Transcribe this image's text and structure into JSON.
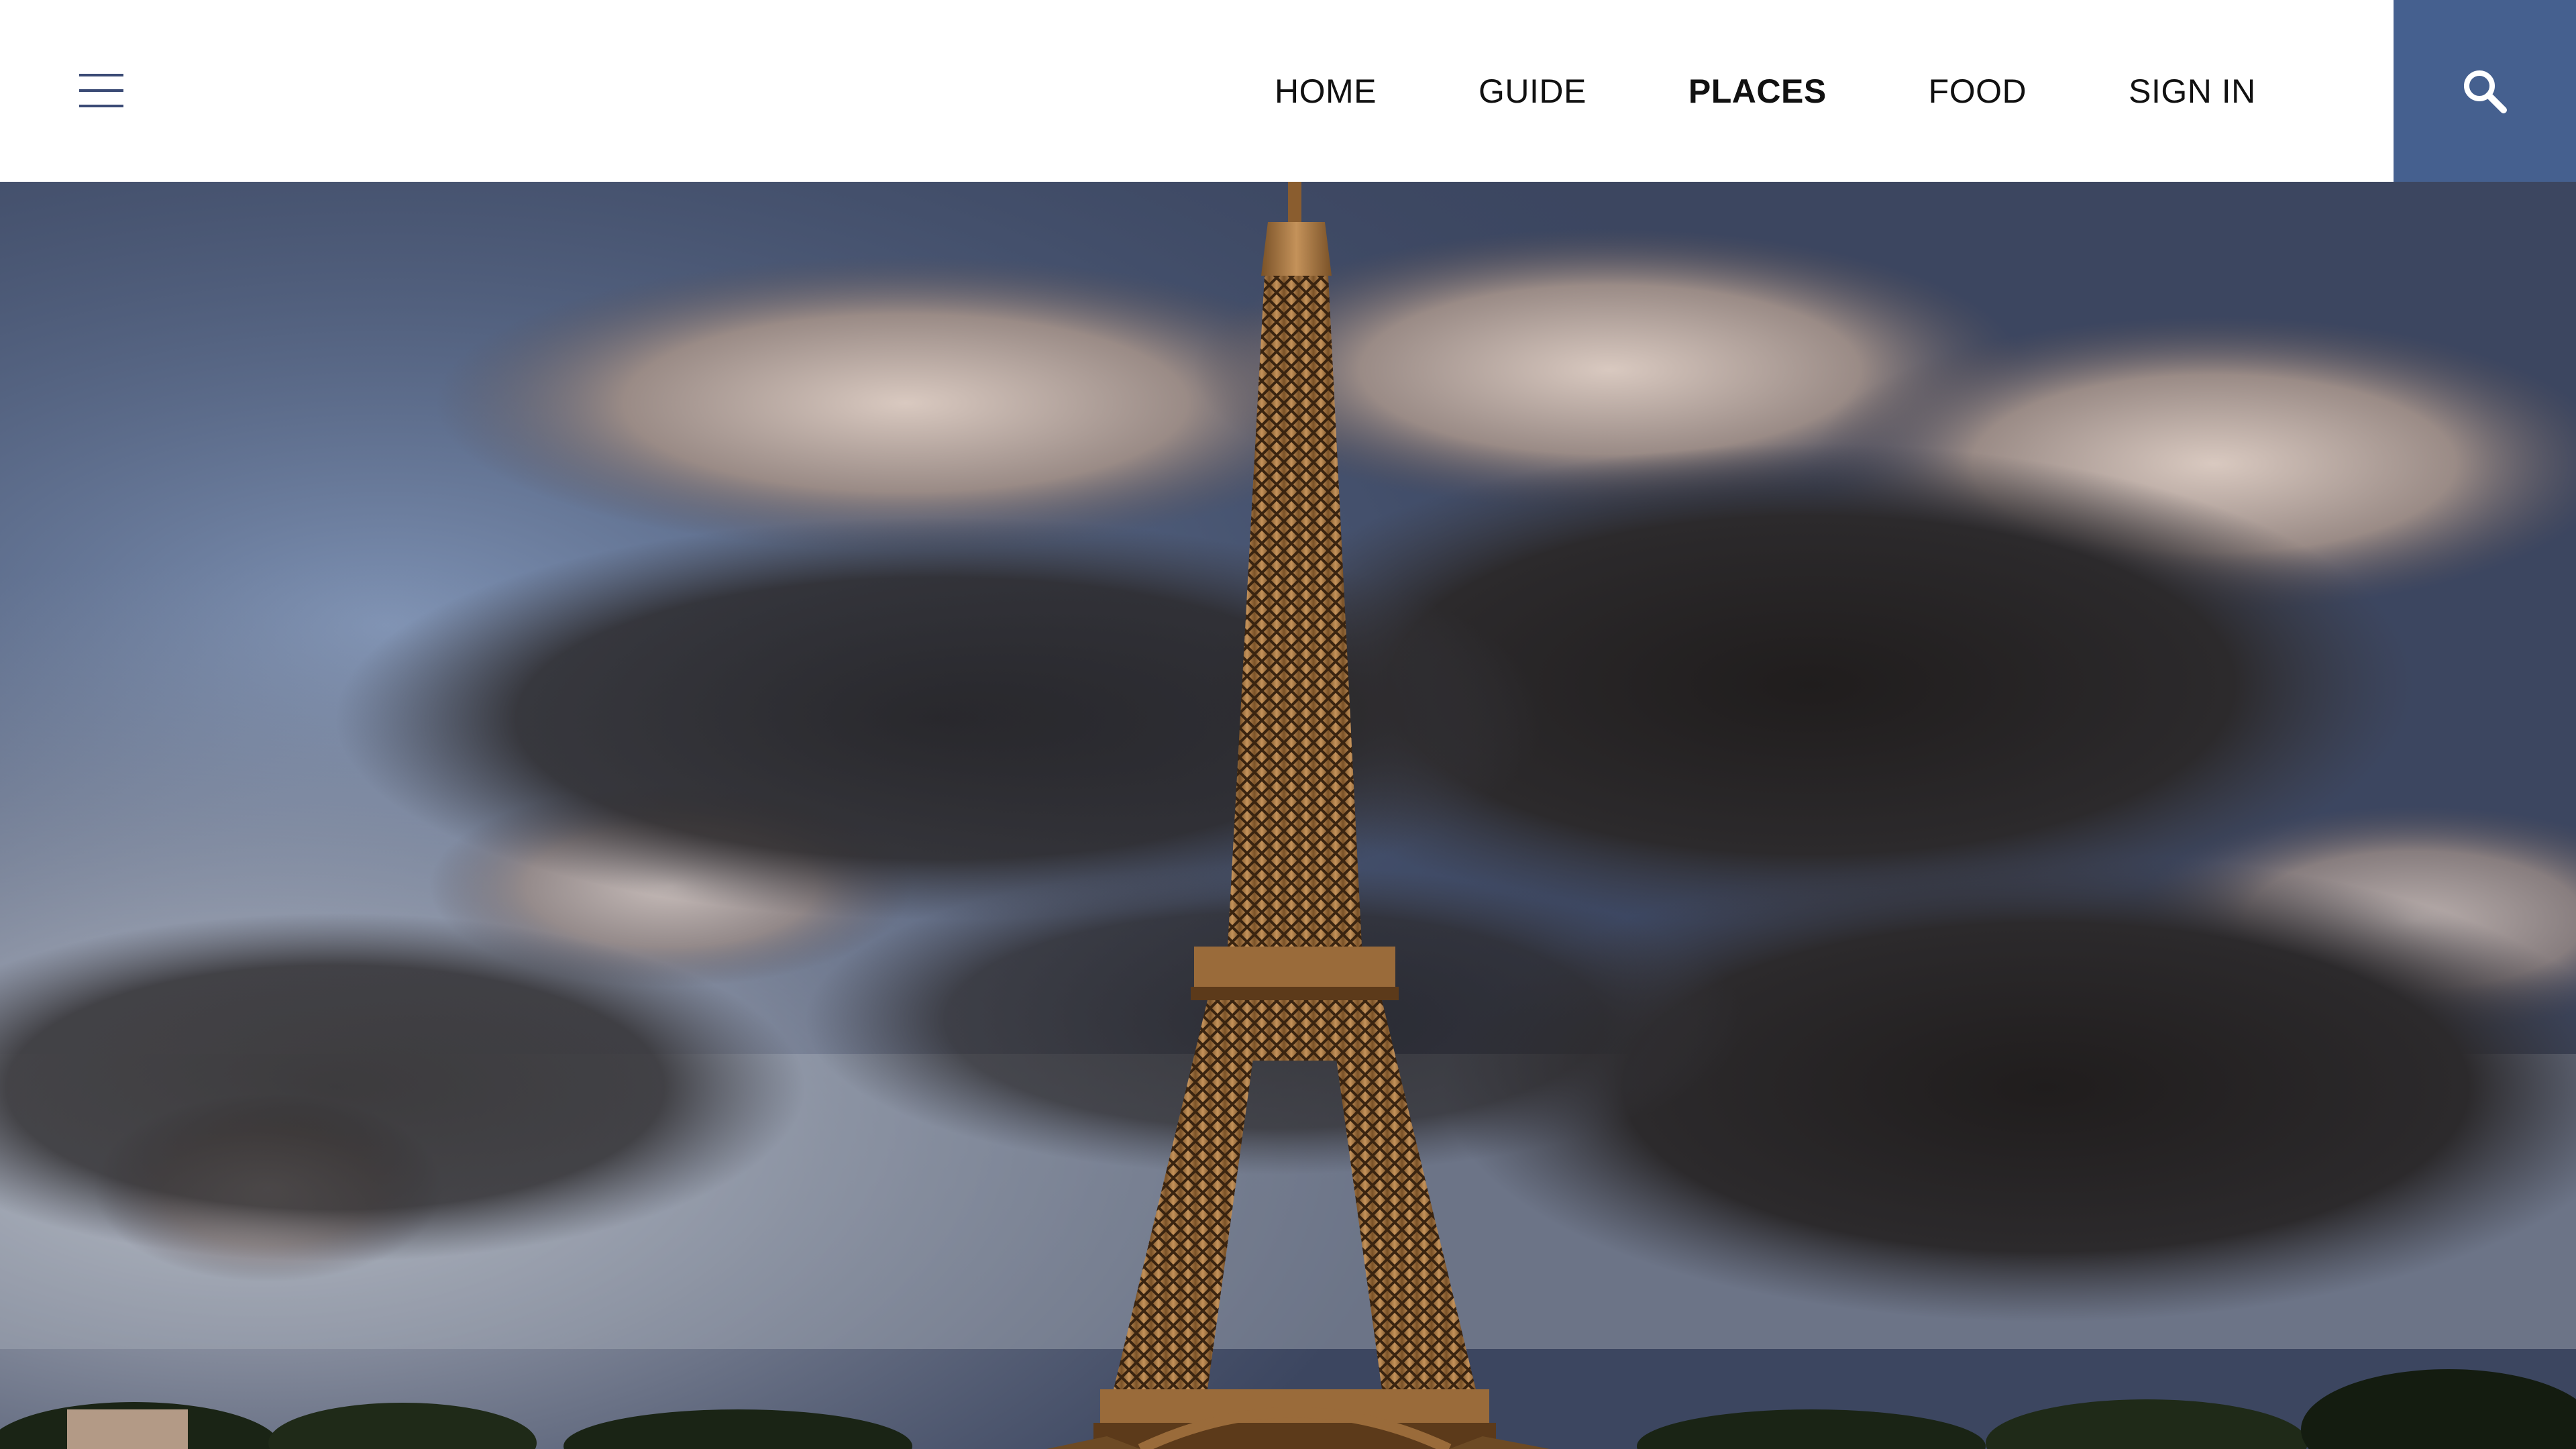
{
  "header": {
    "menu_icon": "hamburger-menu-icon",
    "nav": [
      {
        "label": "HOME",
        "active": false
      },
      {
        "label": "GUIDE",
        "active": false
      },
      {
        "label": "PLACES",
        "active": true
      },
      {
        "label": "FOOD",
        "active": false
      },
      {
        "label": "SIGN IN",
        "active": false
      }
    ],
    "search_icon": "search-icon"
  },
  "hero": {
    "image_subject": "Eiffel Tower under a cloudy sky"
  },
  "colors": {
    "header_bg": "#ffffff",
    "search_bg": "#45608f",
    "menu_icon": "#3a4a75",
    "nav_text": "#111111",
    "tower": "#a97a48"
  }
}
